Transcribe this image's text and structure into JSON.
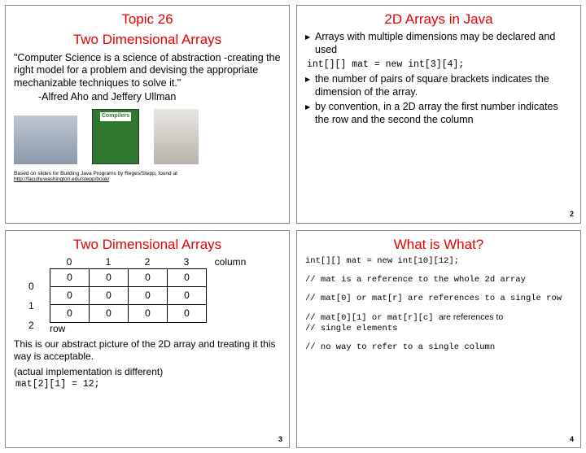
{
  "s1": {
    "topic": "Topic 26",
    "title": "Two Dimensional Arrays",
    "quote": "\"Computer Science is a science of abstraction -creating the right model for a problem and devising the appropriate mechanizable techniques to solve it.\"",
    "attrib": "-Alfred Aho and Jeffery Ullman",
    "book": "Compilers",
    "foot1": "Based on slides for Building Java Programs by Reges/Stepp, found at",
    "foot2": "http://faculty.washington.edu/stepp/book/"
  },
  "s2": {
    "title": "2D Arrays in Java",
    "b1": "Arrays with multiple dimensions may be declared and used",
    "code": "int[][] mat = new int[3][4];",
    "b2": "the number of pairs of square brackets indicates the dimension of the array.",
    "b3": "by convention, in a 2D array the first number indicates the row and the second the column",
    "page": "2"
  },
  "s3": {
    "title": "Two Dimensional Arrays",
    "cols": {
      "c0": "0",
      "c1": "1",
      "c2": "2",
      "c3": "3",
      "lbl": "column"
    },
    "rows": {
      "r0": "0",
      "r1": "1",
      "r2": "2",
      "lbl": "row"
    },
    "cell": "0",
    "txt1": "This is our abstract picture of the 2D array and treating it this way is acceptable.",
    "txt2": "(actual implementation is different)",
    "code": "mat[2][1] = 12;",
    "page": "3"
  },
  "s4": {
    "title": "What is What?",
    "l1": "int[][] mat = new int[10][12];",
    "l2": "// mat is a reference to the whole 2d array",
    "l3": "// mat[0] or mat[r] are references to a single row",
    "l4a": "// mat[0][1] or mat[r][c] ",
    "l4b": "are references to",
    "l5": "// single elements",
    "l6": "// no way to refer to a single column",
    "page": "4"
  }
}
